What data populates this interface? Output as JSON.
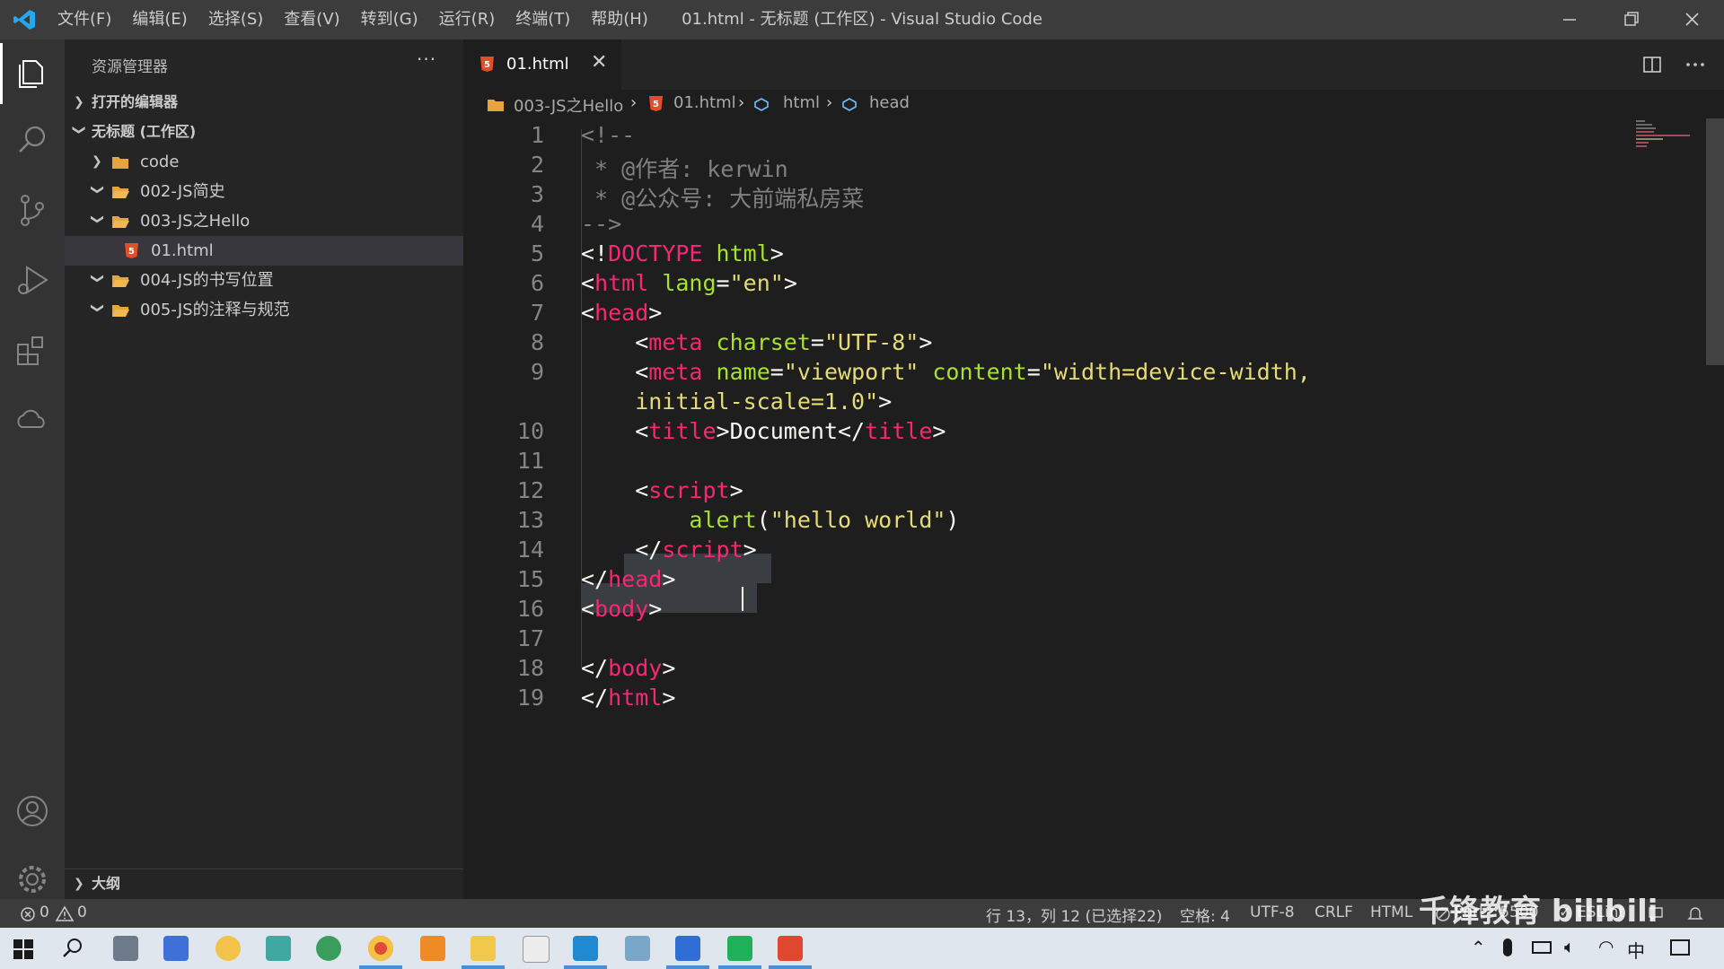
{
  "titlebar": {
    "menu": [
      "文件(F)",
      "编辑(E)",
      "选择(S)",
      "查看(V)",
      "转到(G)",
      "运行(R)",
      "终端(T)",
      "帮助(H)"
    ],
    "window_title": "01.html - 无标题 (工作区) - Visual Studio Code"
  },
  "sidebar": {
    "title": "资源管理器",
    "more": "···",
    "open_editors": "打开的编辑器",
    "workspace": "无标题 (工作区)",
    "items": [
      {
        "label": "code"
      },
      {
        "label": "002-JS简史"
      },
      {
        "label": "003-JS之Hello"
      },
      {
        "label": "01.html"
      },
      {
        "label": "004-JS的书写位置"
      },
      {
        "label": "005-JS的注释与规范"
      }
    ],
    "outline": "大纲"
  },
  "editor": {
    "tab_label": "01.html",
    "tab_close": "✕",
    "breadcrumb": [
      "003-JS之Hello",
      "01.html",
      "html",
      "head"
    ],
    "line_numbers": [
      "1",
      "2",
      "3",
      "4",
      "5",
      "6",
      "7",
      "8",
      "9",
      "",
      "10",
      "11",
      "12",
      "13",
      "14",
      "15",
      "16",
      "17",
      "18",
      "19"
    ],
    "lines": {
      "l1": "<!--",
      "l2": " * @作者: kerwin",
      "l3": " * @公众号: 大前端私房菜",
      "l4": "-->",
      "l5a": "<!",
      "l5b": "DOCTYPE",
      "l5c": " html",
      "l5d": ">",
      "l6a": "<",
      "l6b": "html",
      "l6c": " lang",
      "l6d": "=",
      "l6e": "\"en\"",
      "l6f": ">",
      "l7a": "<",
      "l7b": "head",
      "l7c": ">",
      "l8a": "    <",
      "l8b": "meta",
      "l8c": " charset",
      "l8d": "=",
      "l8e": "\"UTF-8\"",
      "l8f": ">",
      "l9a": "    <",
      "l9b": "meta",
      "l9c": " name",
      "l9d": "=",
      "l9e": "\"viewport\"",
      "l9f": " content",
      "l9g": "=",
      "l9h": "\"width=device-width,",
      "l9i": "    initial-scale=1.0\"",
      "l9j": ">",
      "l10a": "    <",
      "l10b": "title",
      "l10c": ">Document</",
      "l10d": "title",
      "l10e": ">",
      "l12a": "    <",
      "l12b": "script",
      "l12c": ">",
      "l13a": "        ",
      "l13b": "alert",
      "l13c": "(",
      "l13d": "\"hello world\"",
      "l13e": ")",
      "l14a": "    </",
      "l14b": "script",
      "l14c": ">",
      "l15a": "</",
      "l15b": "head",
      "l15c": ">",
      "l16a": "<",
      "l16b": "body",
      "l16c": ">",
      "l18a": "</",
      "l18b": "body",
      "l18c": ">",
      "l19a": "</",
      "l19b": "html",
      "l19c": ">"
    }
  },
  "statusbar": {
    "errors": "0",
    "warnings": "0",
    "position": "行 13，列 12 (已选择22)",
    "spaces": "空格: 4",
    "encoding": "UTF-8",
    "eol": "CRLF",
    "language": "HTML",
    "port": "Port : 5500",
    "eslint": "ESLint"
  },
  "taskbar": {
    "ime": "中"
  },
  "watermark": "千锋教育 bilibili",
  "colors": {
    "tag": "#f92672",
    "attr": "#a6e22e",
    "string": "#e6db74",
    "comment": "#6a9955",
    "accent": "#007acc"
  }
}
